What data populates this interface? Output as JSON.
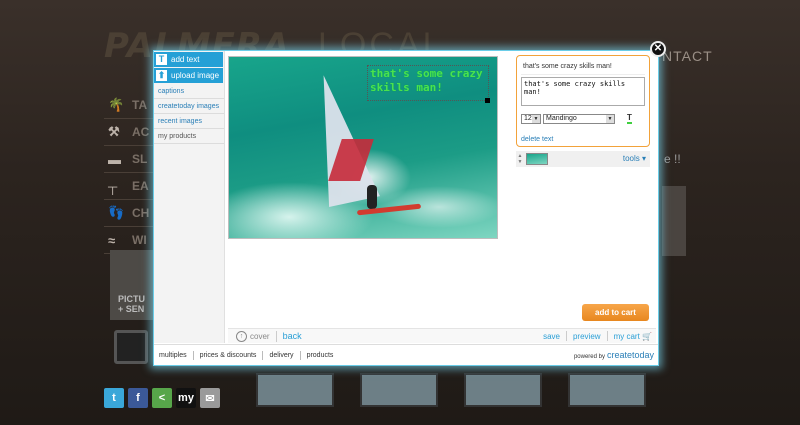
{
  "background": {
    "logo": "PALMERA",
    "logo_suffix": "LOCAL",
    "contact": "NTACT",
    "side_text": "e !!",
    "picture_label": "PICTU\n+ SEN",
    "nav_items": [
      {
        "icon": "palm-tree-icon",
        "glyph": "🌴",
        "label": "TA"
      },
      {
        "icon": "hammer-icon",
        "glyph": "⚒",
        "label": "AC"
      },
      {
        "icon": "bed-icon",
        "glyph": "▬",
        "label": "SL"
      },
      {
        "icon": "picnic-table-icon",
        "glyph": "┬",
        "label": "EA"
      },
      {
        "icon": "footprints-icon",
        "glyph": "👣",
        "label": "CH"
      },
      {
        "icon": "waves-icon",
        "glyph": "≈",
        "label": "WI"
      }
    ],
    "social": [
      {
        "icon": "twitter-icon",
        "glyph": "t",
        "color": "#3aa7d9"
      },
      {
        "icon": "facebook-icon",
        "glyph": "f",
        "color": "#3b5998"
      },
      {
        "icon": "share-icon",
        "glyph": "<",
        "color": "#57a64a"
      },
      {
        "icon": "myspace-icon",
        "glyph": "my",
        "color": "#111111"
      },
      {
        "icon": "email-icon",
        "glyph": "✉",
        "color": "#9a9a9a"
      }
    ]
  },
  "editor": {
    "tools": {
      "add_text": "add text",
      "upload_image": "upload image"
    },
    "menu": [
      "captions",
      "createtoday images",
      "recent images",
      "my products"
    ],
    "canvas": {
      "overlay_text": "that's some crazy skills man!"
    },
    "text_panel": {
      "title": "that's some crazy skills man!",
      "value": "that's some crazy skills man!",
      "font_size": "12",
      "font_family": "Mandingo",
      "delete_label": "delete text"
    },
    "layers": {
      "tools_label": "tools ▾"
    },
    "add_to_cart": "add to cart",
    "bottom": {
      "cover": "cover",
      "back": "back",
      "save": "save",
      "preview": "preview",
      "my_cart": "my cart"
    },
    "footer": {
      "links": [
        "multiples",
        "prices & discounts",
        "delivery",
        "products"
      ],
      "powered_by": "powered by",
      "brand": "createtoday"
    },
    "colors": {
      "accent": "#25a0d6",
      "cart": "#f09a30",
      "overlay_text": "#4be14f"
    }
  }
}
